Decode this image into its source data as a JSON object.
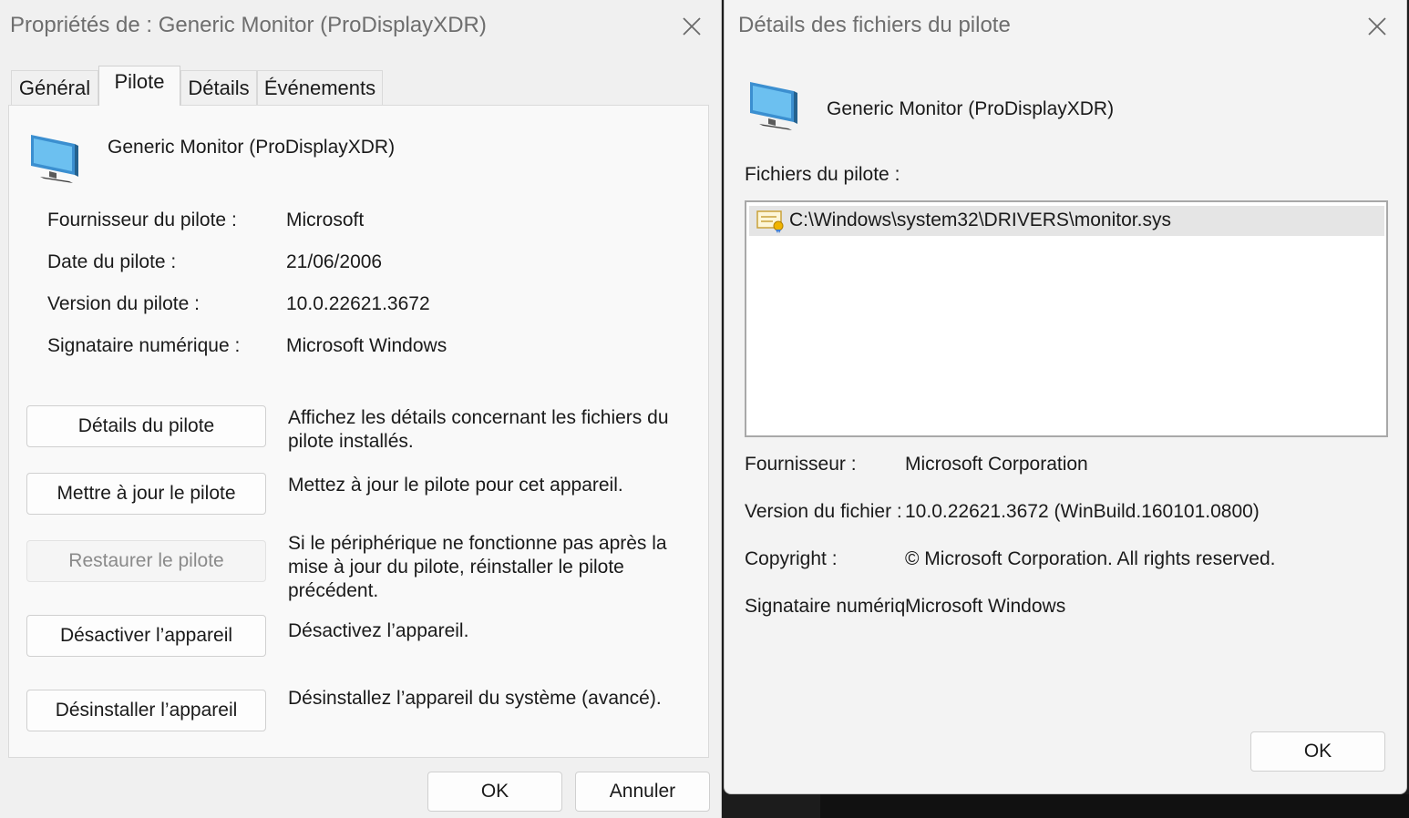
{
  "left_dialog": {
    "title": "Propriétés de : Generic Monitor (ProDisplayXDR)",
    "tabs": [
      "Général",
      "Pilote",
      "Détails",
      "Événements"
    ],
    "active_tab": "Pilote",
    "device_name": "Generic Monitor (ProDisplayXDR)",
    "info": [
      {
        "label": "Fournisseur du pilote :",
        "value": "Microsoft"
      },
      {
        "label": "Date du pilote :",
        "value": "21/06/2006"
      },
      {
        "label": "Version du pilote :",
        "value": "10.0.22621.3672"
      },
      {
        "label": "Signataire numérique :",
        "value": "Microsoft Windows"
      }
    ],
    "actions": [
      {
        "button": "Détails du pilote",
        "description": "Affichez les détails concernant les fichiers du pilote installés.",
        "enabled": true
      },
      {
        "button": "Mettre à jour le pilote",
        "description": "Mettez à jour le pilote pour cet appareil.",
        "enabled": true
      },
      {
        "button": "Restaurer le pilote",
        "description": "Si le périphérique ne fonctionne pas après la mise à jour du pilote, réinstaller le pilote précédent.",
        "enabled": false
      },
      {
        "button": "Désactiver l’appareil",
        "description": "Désactivez l’appareil.",
        "enabled": true
      },
      {
        "button": "Désinstaller l’appareil",
        "description": "Désinstallez l’appareil du système (avancé).",
        "enabled": true
      }
    ],
    "ok_label": "OK",
    "cancel_label": "Annuler"
  },
  "right_dialog": {
    "title": "Détails des fichiers du pilote",
    "device_name": "Generic Monitor (ProDisplayXDR)",
    "files_label": "Fichiers du pilote :",
    "files": [
      "C:\\Windows\\system32\\DRIVERS\\monitor.sys"
    ],
    "details": [
      {
        "label": "Fournisseur :",
        "value": "Microsoft Corporation"
      },
      {
        "label": "Version du fichier :",
        "value": "10.0.22621.3672 (WinBuild.160101.0800)"
      },
      {
        "label": "Copyright :",
        "value": "© Microsoft Corporation. All rights reserved."
      },
      {
        "label": "Signataire numériq",
        "value": "Microsoft Windows"
      }
    ],
    "ok_label": "OK"
  },
  "icons": {
    "close": "close-icon",
    "monitor": "monitor-icon",
    "file": "certificate-file-icon"
  },
  "colors": {
    "dialog_bg": "#f0f0f0",
    "panel_bg": "#f9f9f9",
    "title_text": "#6e6e6e",
    "monitor_blue": "#4aa3df",
    "selection_row": "#e5e5e5"
  }
}
